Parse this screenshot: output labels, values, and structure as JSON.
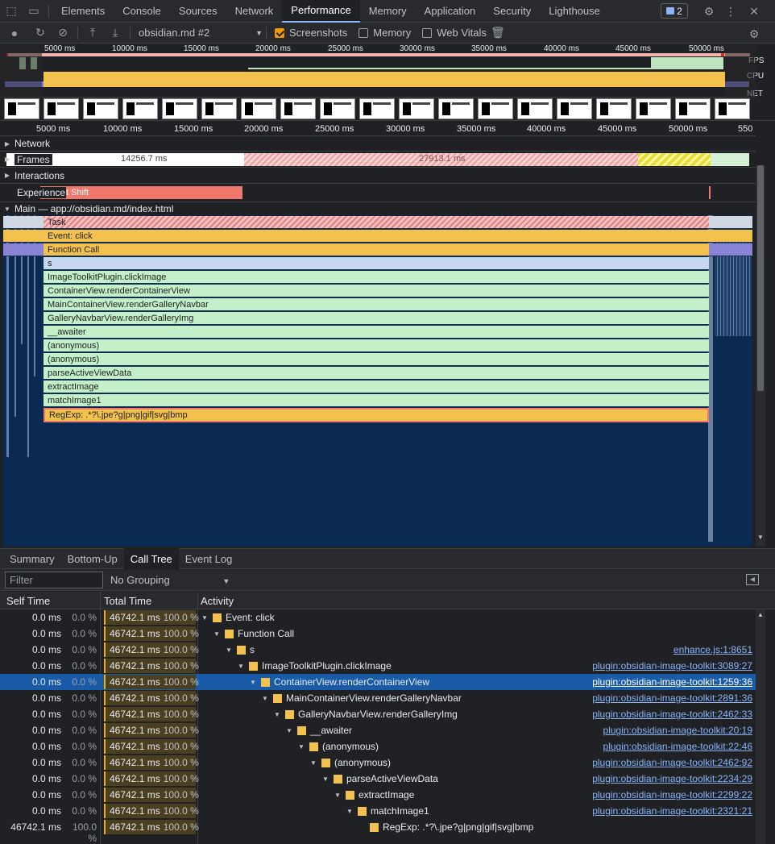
{
  "devtools": {
    "tabs": [
      "Elements",
      "Console",
      "Sources",
      "Network",
      "Performance",
      "Memory",
      "Application",
      "Security",
      "Lighthouse"
    ],
    "active_tab": "Performance",
    "issues_count": "2"
  },
  "toolbar": {
    "recording_select": "obsidian.md #2",
    "screenshots_label": "Screenshots",
    "screenshots_checked": true,
    "memory_label": "Memory",
    "memory_checked": false,
    "webvitals_label": "Web Vitals",
    "webvitals_checked": false
  },
  "overview": {
    "ticks": [
      "5000 ms",
      "10000 ms",
      "15000 ms",
      "20000 ms",
      "25000 ms",
      "30000 ms",
      "35000 ms",
      "40000 ms",
      "45000 ms",
      "50000 ms"
    ],
    "fps_label": "FPS",
    "cpu_label": "CPU",
    "net_label": "NET"
  },
  "ruler": {
    "ticks": [
      "5000 ms",
      "10000 ms",
      "15000 ms",
      "20000 ms",
      "25000 ms",
      "30000 ms",
      "35000 ms",
      "40000 ms",
      "45000 ms",
      "50000 ms",
      "550"
    ]
  },
  "tracks": {
    "network": "Network",
    "frames": "Frames",
    "frames_a": "14256.7 ms",
    "frames_b": "27913.1 ms",
    "interactions": "Interactions",
    "experience": "Experience",
    "layout_shift": "Layout Shift",
    "main": "Main — app://obsidian.md/index.html"
  },
  "flame": [
    {
      "label": "Task",
      "kind": "task"
    },
    {
      "label": "Event: click",
      "kind": "yellow"
    },
    {
      "label": "Function Call",
      "kind": "yellow"
    },
    {
      "label": "s",
      "kind": "blue"
    },
    {
      "label": "ImageToolkitPlugin.clickImage",
      "kind": "green"
    },
    {
      "label": "ContainerView.renderContainerView",
      "kind": "green"
    },
    {
      "label": "MainContainerView.renderGalleryNavbar",
      "kind": "green"
    },
    {
      "label": "GalleryNavbarView.renderGalleryImg",
      "kind": "green"
    },
    {
      "label": "__awaiter",
      "kind": "green"
    },
    {
      "label": "(anonymous)",
      "kind": "green"
    },
    {
      "label": "(anonymous)",
      "kind": "green"
    },
    {
      "label": "parseActiveViewData",
      "kind": "green"
    },
    {
      "label": "extractImage",
      "kind": "green"
    },
    {
      "label": "matchImage1",
      "kind": "green"
    },
    {
      "label": "RegExp: .*?\\.jpe?g|png|gif|svg|bmp",
      "kind": "regexp"
    }
  ],
  "bottom": {
    "tabs": [
      "Summary",
      "Bottom-Up",
      "Call Tree",
      "Event Log"
    ],
    "active_tab": "Call Tree",
    "filter_placeholder": "Filter",
    "grouping": "No Grouping",
    "headers": {
      "self": "Self Time",
      "total": "Total Time",
      "activity": "Activity"
    }
  },
  "rows": [
    {
      "self": "0.0 ms",
      "self_pct": "0.0 %",
      "total": "46742.1 ms",
      "total_pct": "100.0 %",
      "name": "Event: click",
      "depth": 0,
      "url": "",
      "selected": false
    },
    {
      "self": "0.0 ms",
      "self_pct": "0.0 %",
      "total": "46742.1 ms",
      "total_pct": "100.0 %",
      "name": "Function Call",
      "depth": 1,
      "url": "",
      "selected": false
    },
    {
      "self": "0.0 ms",
      "self_pct": "0.0 %",
      "total": "46742.1 ms",
      "total_pct": "100.0 %",
      "name": "s",
      "depth": 2,
      "url": "enhance.js:1:8651",
      "selected": false
    },
    {
      "self": "0.0 ms",
      "self_pct": "0.0 %",
      "total": "46742.1 ms",
      "total_pct": "100.0 %",
      "name": "ImageToolkitPlugin.clickImage",
      "depth": 3,
      "url": "plugin:obsidian-image-toolkit:3089:27",
      "selected": false
    },
    {
      "self": "0.0 ms",
      "self_pct": "0.0 %",
      "total": "46742.1 ms",
      "total_pct": "100.0 %",
      "name": "ContainerView.renderContainerView",
      "depth": 4,
      "url": "plugin:obsidian-image-toolkit:1259:36",
      "selected": true
    },
    {
      "self": "0.0 ms",
      "self_pct": "0.0 %",
      "total": "46742.1 ms",
      "total_pct": "100.0 %",
      "name": "MainContainerView.renderGalleryNavbar",
      "depth": 5,
      "url": "plugin:obsidian-image-toolkit:2891:36",
      "selected": false
    },
    {
      "self": "0.0 ms",
      "self_pct": "0.0 %",
      "total": "46742.1 ms",
      "total_pct": "100.0 %",
      "name": "GalleryNavbarView.renderGalleryImg",
      "depth": 6,
      "url": "plugin:obsidian-image-toolkit:2462:33",
      "selected": false
    },
    {
      "self": "0.0 ms",
      "self_pct": "0.0 %",
      "total": "46742.1 ms",
      "total_pct": "100.0 %",
      "name": "__awaiter",
      "depth": 7,
      "url": "plugin:obsidian-image-toolkit:20:19",
      "selected": false
    },
    {
      "self": "0.0 ms",
      "self_pct": "0.0 %",
      "total": "46742.1 ms",
      "total_pct": "100.0 %",
      "name": "(anonymous)",
      "depth": 8,
      "url": "plugin:obsidian-image-toolkit:22:46",
      "selected": false
    },
    {
      "self": "0.0 ms",
      "self_pct": "0.0 %",
      "total": "46742.1 ms",
      "total_pct": "100.0 %",
      "name": "(anonymous)",
      "depth": 9,
      "url": "plugin:obsidian-image-toolkit:2462:92",
      "selected": false
    },
    {
      "self": "0.0 ms",
      "self_pct": "0.0 %",
      "total": "46742.1 ms",
      "total_pct": "100.0 %",
      "name": "parseActiveViewData",
      "depth": 10,
      "url": "plugin:obsidian-image-toolkit:2234:29",
      "selected": false
    },
    {
      "self": "0.0 ms",
      "self_pct": "0.0 %",
      "total": "46742.1 ms",
      "total_pct": "100.0 %",
      "name": "extractImage",
      "depth": 11,
      "url": "plugin:obsidian-image-toolkit:2299:22",
      "selected": false
    },
    {
      "self": "0.0 ms",
      "self_pct": "0.0 %",
      "total": "46742.1 ms",
      "total_pct": "100.0 %",
      "name": "matchImage1",
      "depth": 12,
      "url": "plugin:obsidian-image-toolkit:2321:21",
      "selected": false
    },
    {
      "self": "46742.1 ms",
      "self_pct": "100.0 %",
      "total": "46742.1 ms",
      "total_pct": "100.0 %",
      "name": "RegExp: .*?\\.jpe?g|png|gif|svg|bmp",
      "depth": 13,
      "url": "",
      "selected": false
    }
  ],
  "colors": {
    "task": "#f0b0b0",
    "yellow": "#f2c14e",
    "green": "#c3f0c8",
    "blue": "#c6d8f0",
    "selected_row": "#1a5ba8",
    "main_bg": "#0b2a52"
  }
}
